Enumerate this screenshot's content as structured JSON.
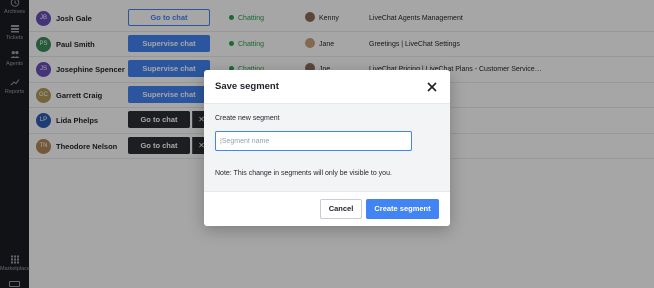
{
  "sidebar": {
    "items": [
      {
        "label": "Archives",
        "icon": "clock-icon"
      },
      {
        "label": "Tickets",
        "icon": "tickets-icon"
      },
      {
        "label": "Agents",
        "icon": "agents-icon"
      },
      {
        "label": "Reports",
        "icon": "reports-icon"
      },
      {
        "label": "Marketplace",
        "icon": "grid-icon"
      }
    ]
  },
  "rows": [
    {
      "initials": "JB",
      "name": "Josh Gale",
      "action": "Go to chat",
      "status": "Chatting",
      "agent": "Kenny",
      "group": "LiveChat Agents Management",
      "avatar_color": "#6b4fbb"
    },
    {
      "initials": "PS",
      "name": "Paul Smith",
      "action": "Supervise chat",
      "status": "Chatting",
      "agent": "Jane",
      "group": "Greetings | LiveChat Settings",
      "avatar_color": "#3a8a5a"
    },
    {
      "initials": "JS",
      "name": "Josephine Spencer",
      "action": "Supervise chat",
      "status": "Chatting",
      "agent": "Joe",
      "group": "LiveChat Pricing | LiveChat Plans - Customer Service…",
      "avatar_color": "#6b4fbb"
    },
    {
      "initials": "GC",
      "name": "Garrett Craig",
      "action": "Supervise chat",
      "avatar_color": "#b39a5a"
    },
    {
      "initials": "LP",
      "name": "Lida Phelps",
      "action": "Go to chat",
      "avatar_color": "#2f5fb3"
    },
    {
      "initials": "TN",
      "name": "Theodore Nelson",
      "action": "Go to chat",
      "avatar_color": "#b3875a"
    }
  ],
  "modal": {
    "title": "Save segment",
    "field_label": "Create new segment",
    "input_value": "",
    "input_placeholder": "|Segment name",
    "note": "Note: This change in segments will only be visible to you.",
    "cancel_label": "Cancel",
    "create_label": "Create segment"
  },
  "colors": {
    "accent": "#4384f5",
    "status_green": "#2ba14b",
    "sidebar_bg": "#1b1d22"
  }
}
